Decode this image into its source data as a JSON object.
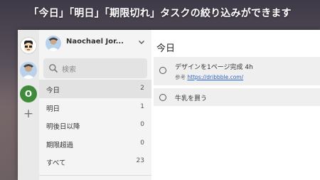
{
  "caption": "「今日」「明日」「期限切れ」タスクの絞り込みができます",
  "accounts": {
    "add_label": "+",
    "third_initial": "O"
  },
  "sidebar": {
    "user_name": "Naochael Jor...",
    "search_placeholder": "検索",
    "items": [
      {
        "label": "今日",
        "count": "2"
      },
      {
        "label": "明日",
        "count": "1"
      },
      {
        "label": "明後日以降",
        "count": "0"
      },
      {
        "label": "期限超過",
        "count": "0"
      },
      {
        "label": "すべて",
        "count": "23"
      }
    ]
  },
  "main": {
    "title": "今日",
    "tasks": [
      {
        "title": "デザインを1ページ完成 4h",
        "note_label": "参考",
        "note_link": "https://dribbble.com/"
      },
      {
        "title": "牛乳を買う"
      }
    ]
  },
  "colors": {
    "accent_green": "#3f8a3b",
    "link_blue": "#2a63c5"
  }
}
